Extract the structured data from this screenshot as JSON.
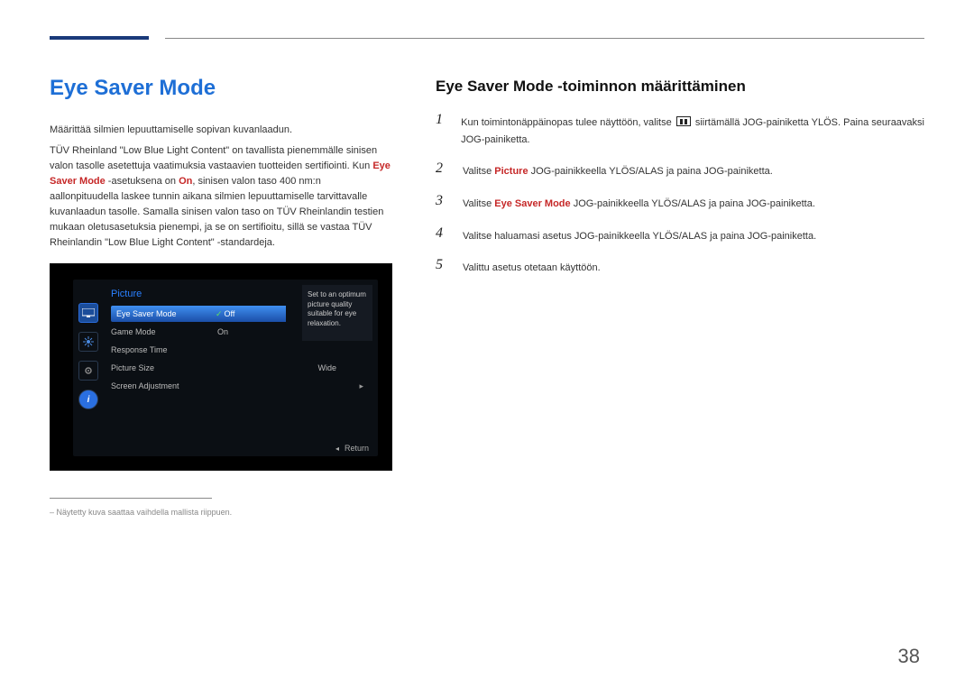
{
  "title_left": "Eye Saver Mode",
  "title_right": "Eye Saver Mode -toiminnon määrittäminen",
  "intro1": "Määrittää silmien lepuuttamiselle sopivan kuvanlaadun.",
  "intro2a": "TÜV Rheinland \"Low Blue Light Content\" on tavallista pienemmälle sinisen valon tasolle asetettuja vaatimuksia vastaavien tuotteiden sertifiointi. Kun ",
  "intro2b": "Eye Saver Mode",
  "intro2c": " -asetuksena on ",
  "intro2d": "On",
  "intro2e": ", sinisen valon taso 400 nm:n aallonpituudella laskee tunnin aikana silmien lepuuttamiselle tarvittavalle kuvanlaadun tasolle. Samalla sinisen valon taso on TÜV Rheinlandin testien mukaan oletusasetuksia pienempi, ja se on sertifioitu, sillä se vastaa TÜV Rheinlandin \"Low Blue Light Content\" -standardeja.",
  "osd": {
    "section_title": "Picture",
    "rows": {
      "eye_saver_label": "Eye Saver Mode",
      "eye_saver_value": "Off",
      "game_mode_label": "Game Mode",
      "game_mode_value": "On",
      "response_time_label": "Response Time",
      "picture_size_label": "Picture Size",
      "picture_size_value": "Wide",
      "screen_adjustment_label": "Screen Adjustment"
    },
    "description": "Set to an optimum picture quality suitable for eye relaxation.",
    "return_label": "Return"
  },
  "footnote": "Näytetty kuva saattaa vaihdella mallista riippuen.",
  "steps": {
    "s1a": "Kun toimintonäppäinopas tulee näyttöön, valitse ",
    "s1b": " siirtämällä JOG-painiketta YLÖS. Paina seuraavaksi JOG-painiketta.",
    "s2a": "Valitse ",
    "s2b": "Picture",
    "s2c": " JOG-painikkeella YLÖS/ALAS ja paina JOG-painiketta.",
    "s3a": "Valitse ",
    "s3b": "Eye Saver Mode",
    "s3c": " JOG-painikkeella YLÖS/ALAS ja paina JOG-painiketta.",
    "s4": "Valitse haluamasi asetus JOG-painikkeella YLÖS/ALAS ja paina JOG-painiketta.",
    "s5": "Valittu asetus otetaan käyttöön."
  },
  "page_number": "38"
}
